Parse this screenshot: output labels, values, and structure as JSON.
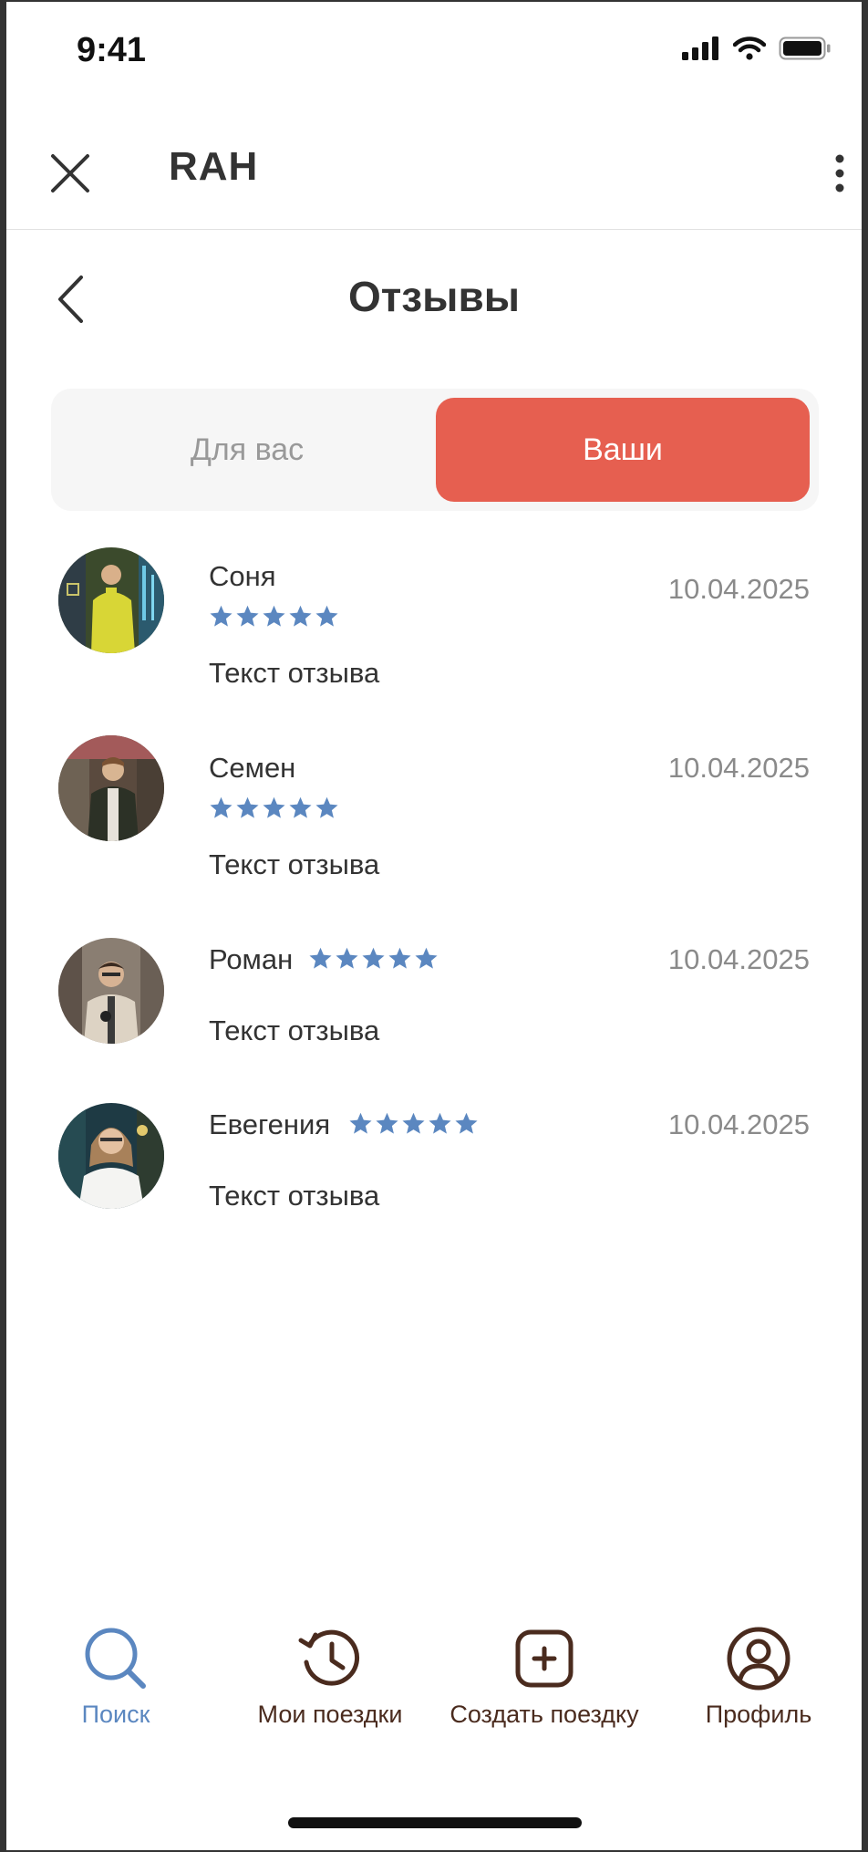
{
  "status_bar": {
    "time": "9:41"
  },
  "header": {
    "title": "RAH"
  },
  "page": {
    "title": "Отзывы"
  },
  "tabs": [
    {
      "label": "Для вас",
      "active": false
    },
    {
      "label": "Ваши",
      "active": true
    }
  ],
  "reviews": [
    {
      "name": "Соня",
      "date": "10.04.2025",
      "rating": 5,
      "text": "Текст отзыва"
    },
    {
      "name": "Семен",
      "date": "10.04.2025",
      "rating": 5,
      "text": "Текст отзыва"
    },
    {
      "name": "Роман",
      "date": "10.04.2025",
      "rating": 5,
      "text": "Текст отзыва"
    },
    {
      "name": "Евегения",
      "date": "10.04.2025",
      "rating": 5,
      "text": "Текст отзыва"
    }
  ],
  "tab_bar": [
    {
      "label": "Поиск",
      "icon": "search-icon",
      "active": true
    },
    {
      "label": "Мои поездки",
      "icon": "history-icon",
      "active": false
    },
    {
      "label": "Создать поездку",
      "icon": "add-square-icon",
      "active": false
    },
    {
      "label": "Профиль",
      "icon": "profile-icon",
      "active": false
    }
  ],
  "colors": {
    "accent": "#e65f50",
    "star": "#5b87c0",
    "tab_active": "#5b87c0",
    "tab_inactive": "#4a2b1e",
    "muted": "#8a8a8a"
  }
}
